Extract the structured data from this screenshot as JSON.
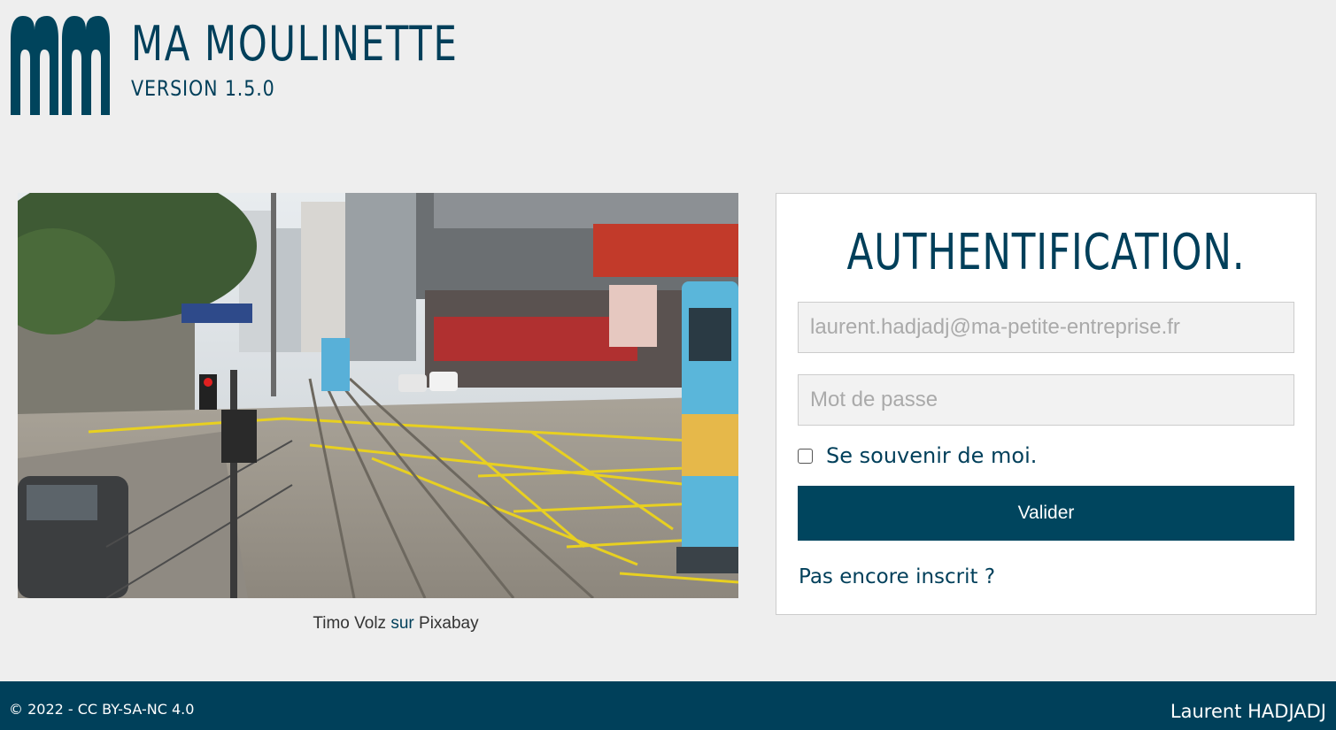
{
  "header": {
    "title": "MA MOULINETTE",
    "version": "VERSION 1.5.0",
    "logo_icon": "mm-logo-icon"
  },
  "photo": {
    "credit_author": "Timo Volz",
    "credit_sep": "sur",
    "credit_site": "Pixabay"
  },
  "auth": {
    "title": "AUTHENTIFICATION.",
    "email_placeholder": "laurent.hadjadj@ma-petite-entreprise.fr",
    "password_placeholder": "Mot de passe",
    "remember_label": "Se souvenir de moi.",
    "submit_label": "Valider",
    "register_link": "Pas encore inscrit ?"
  },
  "footer": {
    "copyright": "© 2022 - CC BY-SA-NC 4.0",
    "author": "Laurent HADJADJ"
  },
  "colors": {
    "brand": "#003f5a",
    "background": "#eeeeee",
    "footer": "#00405a"
  }
}
